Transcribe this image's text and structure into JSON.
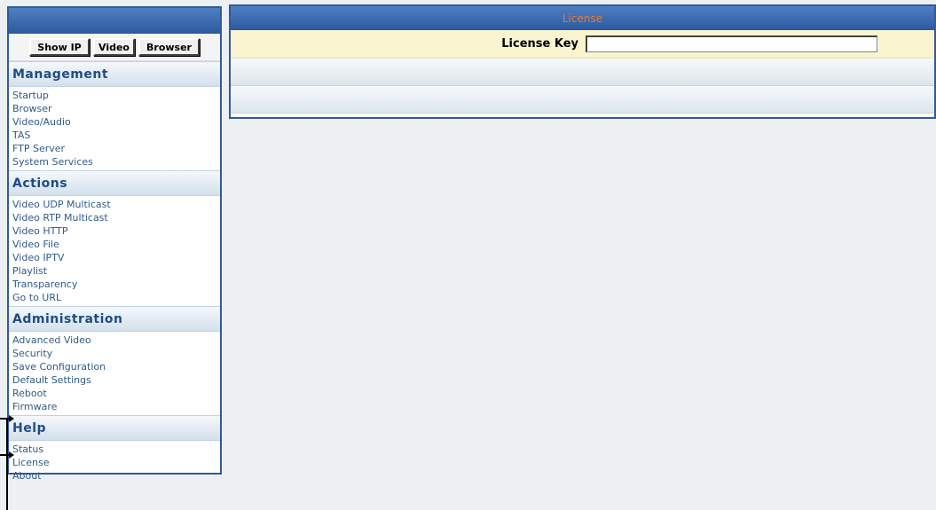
{
  "toolbar": {
    "show_ip_label": "Show IP",
    "video_label": "Video",
    "browser_label": "Browser"
  },
  "sections": [
    {
      "title": "Management",
      "items": [
        "Startup",
        "Browser",
        "Video/Audio",
        "TAS",
        "FTP Server",
        "System Services"
      ]
    },
    {
      "title": "Actions",
      "items": [
        "Video UDP Multicast",
        "Video RTP Multicast",
        "Video HTTP",
        "Video File",
        "Video IPTV",
        "Playlist",
        "Transparency",
        "Go to URL"
      ]
    },
    {
      "title": "Administration",
      "items": [
        "Advanced Video",
        "Security",
        "Save Configuration",
        "Default Settings",
        "Reboot",
        "Firmware"
      ]
    },
    {
      "title": "Help",
      "items": [
        "Status",
        "License",
        "About"
      ]
    }
  ],
  "main": {
    "title": "License",
    "license_key_label": "License Key",
    "license_key_value": ""
  },
  "colors": {
    "header_blue": "#2c5aa0",
    "title_orange": "#e87a2c",
    "form_row_yellow": "#faf5d0",
    "nav_link": "#2f5a88",
    "section_title": "#1e4d84"
  }
}
